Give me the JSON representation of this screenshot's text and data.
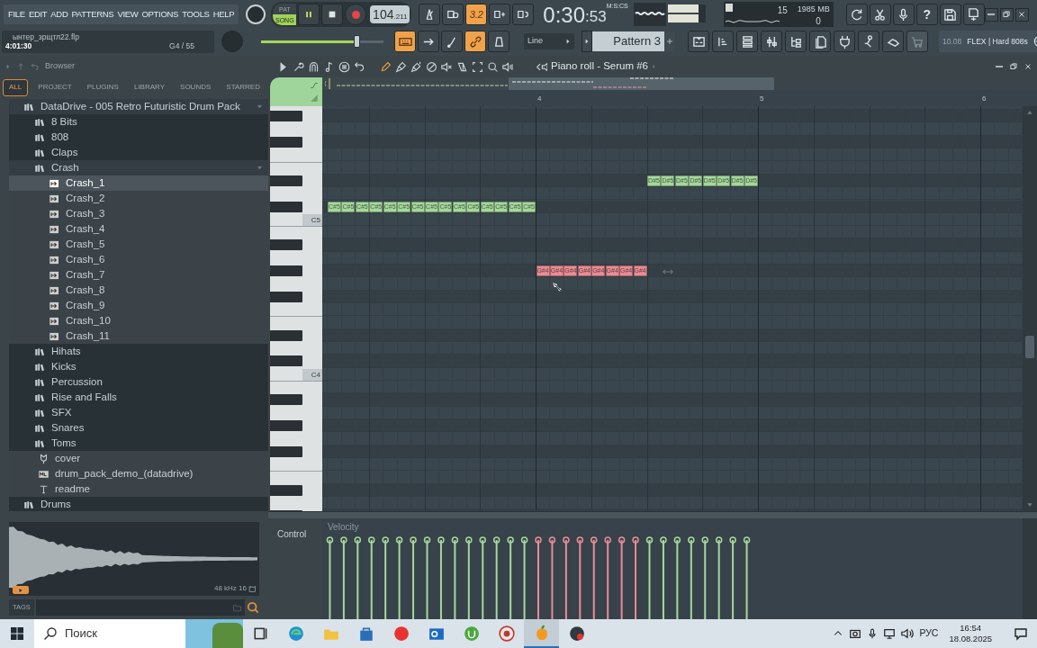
{
  "menu": [
    "FILE",
    "EDIT",
    "ADD",
    "PATTERNS",
    "VIEW",
    "OPTIONS",
    "TOOLS",
    "HELP"
  ],
  "project": {
    "file": "ынтер_зрщтл22.flp",
    "time": "4:01:30",
    "hint": "G4 / 55"
  },
  "transport": {
    "modes": [
      {
        "label": "PAT",
        "selected": false
      },
      {
        "label": "SONG",
        "selected": true
      }
    ],
    "playing": true,
    "tempo": "104",
    "tempo_fraction": ".211"
  },
  "master_volume": {
    "level": 0.78
  },
  "record_buttons": [
    {
      "on": false
    },
    {
      "on": false
    },
    {
      "on": true,
      "label": "3.2"
    },
    {
      "on": false
    },
    {
      "on": false
    }
  ],
  "clock": {
    "time": "0:30",
    "centiseconds": ":53",
    "format": "M:S:CS"
  },
  "monitor": {
    "cpu": "15",
    "memory": "1985 MB",
    "voices": "0"
  },
  "help_label": "?",
  "view_buttons": [
    {
      "on": true
    },
    {
      "on": false
    },
    {
      "on": false
    },
    {
      "on": true
    },
    {
      "on": false
    }
  ],
  "snap": "Line",
  "pattern": "Pattern 3",
  "hint_bar": {
    "version": "10.08",
    "text": "FLEX | Hard 808s"
  },
  "browser": {
    "title": "Browser",
    "tabs": [
      {
        "label": "ALL",
        "selected": true
      },
      {
        "label": "PROJECT",
        "selected": false
      },
      {
        "label": "PLUGINS",
        "selected": false
      },
      {
        "label": "LIBRARY",
        "selected": false
      },
      {
        "label": "SOUNDS",
        "selected": false
      },
      {
        "label": "STARRED",
        "selected": false
      }
    ],
    "tree": [
      {
        "label": "DataDrive - 005 Retro Futuristic Drum Pack",
        "kind": "folder",
        "expanded": true,
        "selected": false,
        "children": [
          {
            "label": "8 Bits",
            "kind": "folder",
            "expanded": false,
            "selected": false
          },
          {
            "label": "808",
            "kind": "folder",
            "expanded": false,
            "selected": false
          },
          {
            "label": "Claps",
            "kind": "folder",
            "expanded": false,
            "selected": false
          },
          {
            "label": "Crash",
            "kind": "folder",
            "expanded": true,
            "selected": false,
            "children": [
              {
                "label": "Crash_1",
                "kind": "sample",
                "selected": true
              },
              {
                "label": "Crash_2",
                "kind": "sample",
                "selected": false
              },
              {
                "label": "Crash_3",
                "kind": "sample",
                "selected": false
              },
              {
                "label": "Crash_4",
                "kind": "sample",
                "selected": false
              },
              {
                "label": "Crash_5",
                "kind": "sample",
                "selected": false
              },
              {
                "label": "Crash_6",
                "kind": "sample",
                "selected": false
              },
              {
                "label": "Crash_7",
                "kind": "sample",
                "selected": false
              },
              {
                "label": "Crash_8",
                "kind": "sample",
                "selected": false
              },
              {
                "label": "Crash_9",
                "kind": "sample",
                "selected": false
              },
              {
                "label": "Crash_10",
                "kind": "sample",
                "selected": false
              },
              {
                "label": "Crash_11",
                "kind": "sample",
                "selected": false
              }
            ]
          },
          {
            "label": "Hihats",
            "kind": "folder",
            "expanded": false,
            "selected": false
          },
          {
            "label": "Kicks",
            "kind": "folder",
            "expanded": false,
            "selected": false
          },
          {
            "label": "Percussion",
            "kind": "folder",
            "expanded": false,
            "selected": false
          },
          {
            "label": "Rise and Falls",
            "kind": "folder",
            "expanded": false,
            "selected": false
          },
          {
            "label": "SFX",
            "kind": "folder",
            "expanded": false,
            "selected": false
          },
          {
            "label": "Snares",
            "kind": "folder",
            "expanded": false,
            "selected": false
          },
          {
            "label": "Toms",
            "kind": "folder",
            "expanded": false,
            "selected": false
          },
          {
            "label": "cover",
            "kind": "image",
            "selected": false
          },
          {
            "label": "drum_pack_demo_(datadrive)",
            "kind": "audio",
            "selected": false
          },
          {
            "label": "readme",
            "kind": "text",
            "selected": false
          }
        ]
      },
      {
        "label": "Drums",
        "kind": "folder",
        "expanded": false,
        "selected": false
      }
    ],
    "preview_info": "48 kHz 16",
    "tags_label": "TAGS"
  },
  "piano_roll": {
    "title": "Piano roll - Serum #6",
    "bars": [
      "4",
      "5",
      "6"
    ],
    "keys": [
      "C5",
      "C4"
    ],
    "note_groups": [
      {
        "color": "#a5d89c",
        "notes": [
          "C#5",
          "C#5",
          "C#5",
          "C#5",
          "C#5",
          "C#5",
          "C#5",
          "C#5",
          "C#5",
          "C#5",
          "C#5",
          "C#5",
          "C#5",
          "C#5",
          "C#5"
        ]
      },
      {
        "color": "#e98c94",
        "notes": [
          "G#4",
          "G#4",
          "G#4",
          "G#4",
          "G#4",
          "G#4",
          "G#4",
          "G#4"
        ]
      },
      {
        "color": "#a5d89c",
        "notes": [
          "D#5",
          "D#5",
          "D#5",
          "D#5",
          "D#5",
          "D#5",
          "D#5",
          "D#5"
        ]
      }
    ],
    "control_label": "Control",
    "control_target": "Velocity"
  },
  "taskbar": {
    "search_placeholder": "Поиск",
    "apps": [
      {
        "selected": false
      },
      {
        "selected": false
      },
      {
        "selected": false
      },
      {
        "selected": false
      },
      {
        "selected": false
      },
      {
        "selected": false
      },
      {
        "selected": false
      },
      {
        "selected": false
      },
      {
        "selected": true
      },
      {
        "selected": false
      }
    ],
    "language": "РУС",
    "time": "16:54",
    "date": "18.08.2025"
  }
}
